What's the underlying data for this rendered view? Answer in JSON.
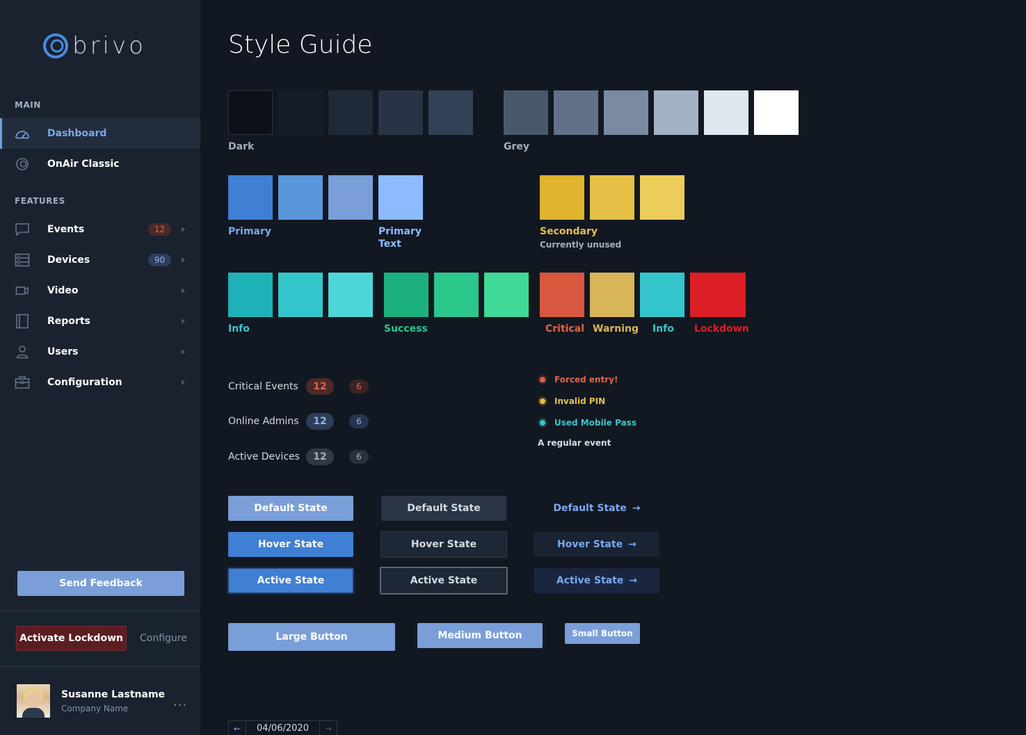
{
  "brand": {
    "name": "brivo"
  },
  "sidebar": {
    "main_label": "MAIN",
    "features_label": "FEATURES",
    "main_items": [
      {
        "label": "Dashboard",
        "icon": "dashboard-gauge-icon"
      },
      {
        "label": "OnAir Classic",
        "icon": "onair-icon"
      }
    ],
    "feature_items": [
      {
        "label": "Events",
        "icon": "chat-bubble-icon",
        "badge": "12"
      },
      {
        "label": "Devices",
        "icon": "server-icon",
        "badge": "90"
      },
      {
        "label": "Video",
        "icon": "video-camera-icon"
      },
      {
        "label": "Reports",
        "icon": "book-icon"
      },
      {
        "label": "Users",
        "icon": "user-icon"
      },
      {
        "label": "Configuration",
        "icon": "briefcase-icon"
      }
    ],
    "send_feedback": "Send Feedback",
    "activate_lockdown": "Activate Lockdown",
    "configure": "Configure",
    "user": {
      "name": "Susanne Lastname",
      "company": "Company Name",
      "more": "..."
    }
  },
  "page": {
    "title": "Style Guide"
  },
  "palette": {
    "dark_label": "Dark",
    "grey_label": "Grey",
    "primary_label": "Primary",
    "primary_text_label_1": "Primary",
    "primary_text_label_2": "Text",
    "secondary_label": "Secondary",
    "secondary_note": "Currently unused",
    "info_label": "Info",
    "success_label": "Success",
    "critical_label": "Critical",
    "warning_label": "Warning",
    "info2_label": "Info",
    "lockdown_label": "Lockdown",
    "colors": {
      "dark": [
        "#0d1117",
        "#161d29",
        "#1f2a38",
        "#283446",
        "#334157"
      ],
      "grey": [
        "#4a586c",
        "#617189",
        "#7a8aa1",
        "#a3b1c4",
        "#e1e7ee",
        "#ffffff"
      ],
      "primary": [
        "#3f7fd4",
        "#5a96db",
        "#7a9fd8",
        "#8cbcff"
      ],
      "secondary": [
        "#e0b42e",
        "#e6c045",
        "#eccc5a"
      ],
      "info": [
        "#1fb1b8",
        "#34c6cc",
        "#4dd6d8"
      ],
      "success": [
        "#1bb07c",
        "#2bc78b",
        "#3ed997"
      ],
      "status": [
        "#d7573f",
        "#d9b55a",
        "#34c6cc",
        "#dc1f26"
      ]
    }
  },
  "metrics": [
    {
      "label": "Critical Events",
      "large": "12",
      "small": "6"
    },
    {
      "label": "Online Admins",
      "large": "12",
      "small": "6"
    },
    {
      "label": "Active Devices",
      "large": "12",
      "small": "6"
    }
  ],
  "events": [
    {
      "text": "Forced entry!",
      "color": "#e3634b"
    },
    {
      "text": "Invalid PIN",
      "color": "#e6c04a"
    },
    {
      "text": "Used Mobile Pass",
      "color": "#3cc6cc"
    },
    {
      "text": "A regular event",
      "color": "#d4dbe6"
    }
  ],
  "buttons": {
    "default_state": "Default State",
    "hover_state": "Hover State",
    "active_state": "Active State",
    "large": "Large Button",
    "medium": "Medium Button",
    "small": "Small Button"
  },
  "date_picker": {
    "value": "04/06/2020"
  }
}
